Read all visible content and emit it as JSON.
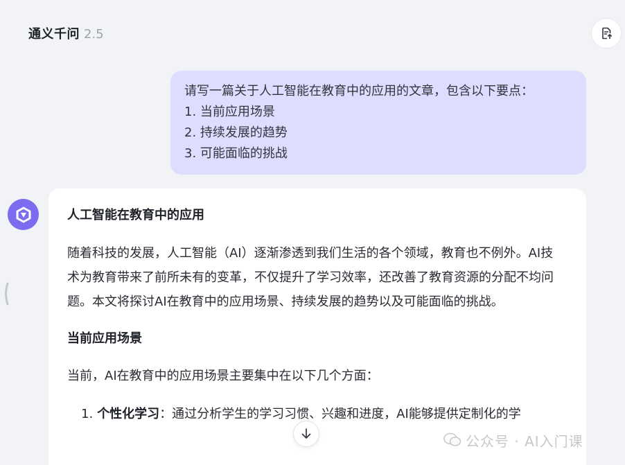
{
  "header": {
    "app_name": "通义千问",
    "version": "2.5",
    "export_icon": "document-export-icon"
  },
  "user_message": {
    "lines": [
      "请写一篇关于人工智能在教育中的应用的文章，包含以下要点：",
      "1. 当前应用场景",
      "2. 持续发展的趋势",
      "3. 可能面临的挑战"
    ]
  },
  "assistant": {
    "avatar_icon": "tongyi-logo-icon",
    "title": "人工智能在教育中的应用",
    "paragraph": "随着科技的发展，人工智能（AI）逐渐渗透到我们生活的各个领域，教育也不例外。AI技术为教育带来了前所未有的变革，不仅提升了学习效率，还改善了教育资源的分配不均问题。本文将探讨AI在教育中的应用场景、持续发展的趋势以及可能面临的挑战。",
    "section_title": "当前应用场景",
    "intro": "当前，AI在教育中的应用场景主要集中在以下几个方面：",
    "list": [
      {
        "num": "1.",
        "term": "个性化学习",
        "text": "：通过分析学生的学习习惯、兴趣和进度，AI能够提供定制化的学"
      }
    ]
  },
  "controls": {
    "scroll_down_icon": "arrow-down-icon",
    "collapse_icon": "collapse-handle-icon"
  },
  "watermark": {
    "text": "公众号 · AI入门课"
  },
  "colors": {
    "background": "#f2f3f6",
    "user_bubble": "#dedcff",
    "avatar": "#7b6cf0",
    "card": "#ffffff"
  }
}
